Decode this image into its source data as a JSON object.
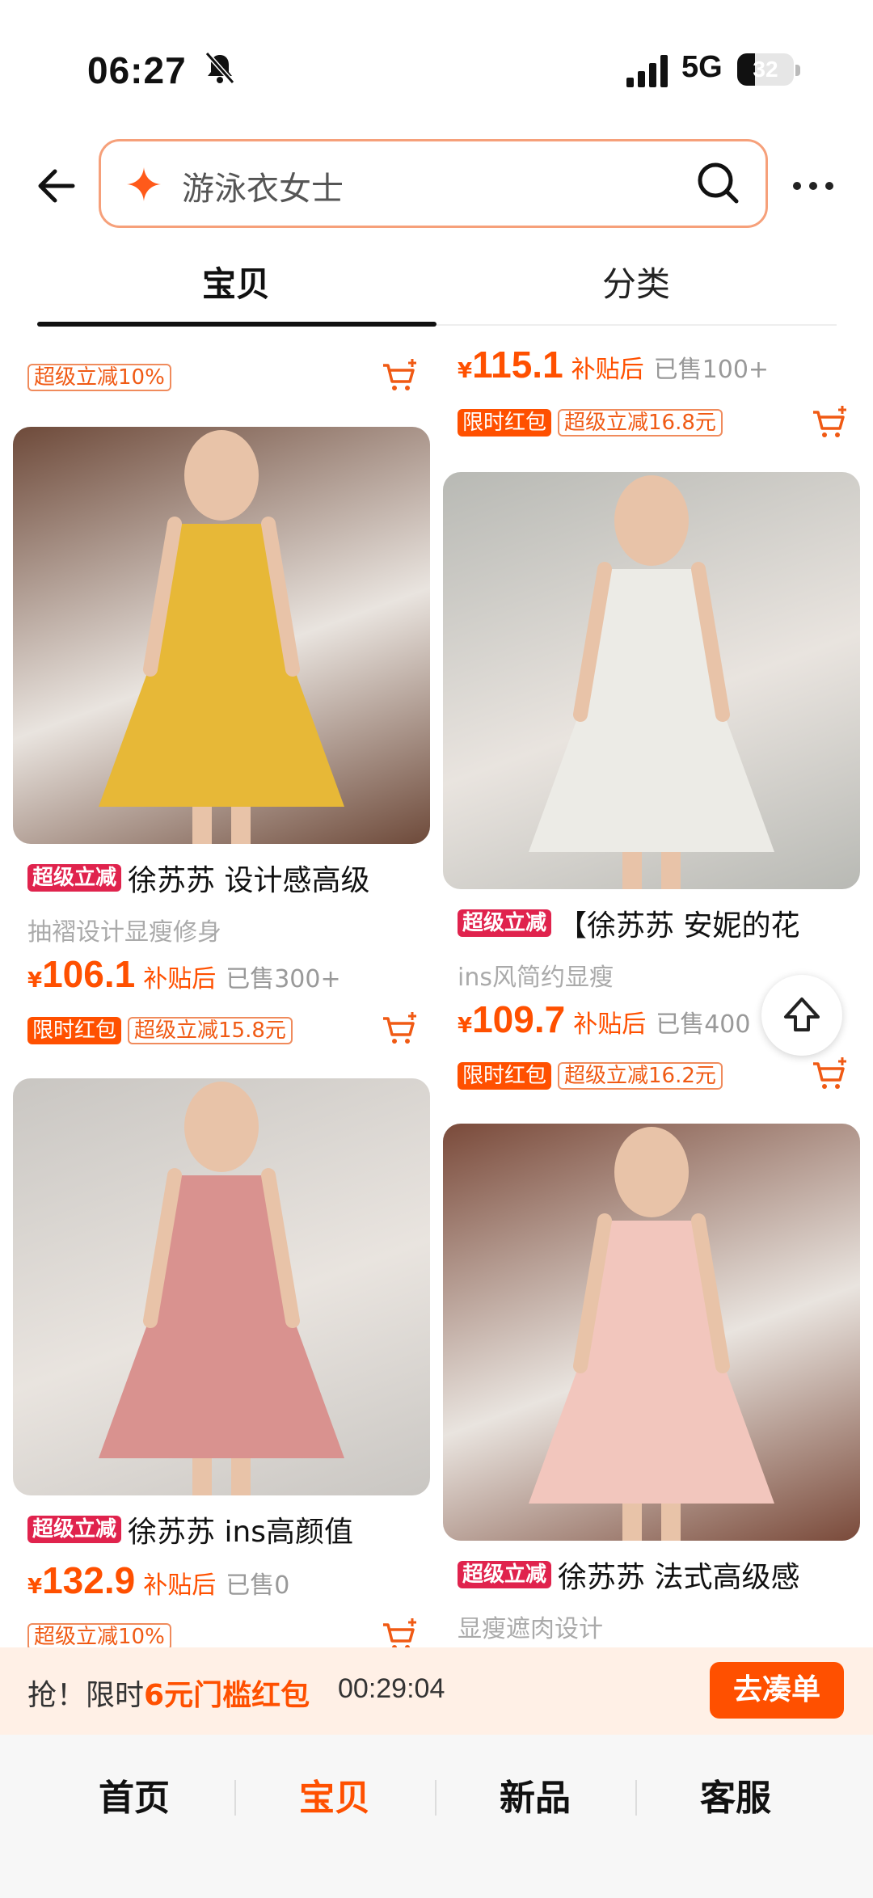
{
  "status_bar": {
    "time": "06:27",
    "network": "5G",
    "battery": "32",
    "battery_level": 0.32
  },
  "header": {
    "search_placeholder": "游泳衣女士"
  },
  "tabs": [
    {
      "label": "宝贝",
      "active": true
    },
    {
      "label": "分类",
      "active": false
    }
  ],
  "partial_top_left": {
    "tag": "超级立减10%"
  },
  "partial_top_right": {
    "yen": "¥",
    "price": "115.1",
    "after": "补贴后",
    "sold": "已售100+",
    "tag1": "限时红包",
    "tag2": "超级立减16.8元"
  },
  "products": [
    {
      "badge": "超级立减",
      "title": "徐苏苏 设计感高级",
      "subtitle": "抽褶设计显瘦修身",
      "yen": "¥",
      "price": "106.1",
      "after": "补贴后",
      "sold": "已售300+",
      "tag1": "限时红包",
      "tag2": "超级立减15.8元",
      "colors": [
        "#e7b837",
        "#6e4a3a"
      ]
    },
    {
      "badge": "超级立减",
      "title": "【徐苏苏 安妮的花",
      "subtitle": "ins风简约显瘦",
      "yen": "¥",
      "price": "109.7",
      "after": "补贴后",
      "sold": "已售400",
      "tag1": "限时红包",
      "tag2": "超级立减16.2元",
      "colors": [
        "#ecebe6",
        "#b8b9b4"
      ]
    },
    {
      "badge": "超级立减",
      "title": "徐苏苏 ins高颜值",
      "yen": "¥",
      "price": "132.9",
      "after": "补贴后",
      "sold": "已售0",
      "tag2": "超级立减10%",
      "colors": [
        "#d9928f",
        "#c9c6c2"
      ]
    },
    {
      "badge": "超级立减",
      "title": "徐苏苏 法式高级感",
      "subtitle": "显瘦遮肉设计",
      "colors": [
        "#f2c6bd",
        "#7a4a3a"
      ]
    }
  ],
  "promo": {
    "prefix": "抢！限时",
    "highlight": "6元门槛红包",
    "timer": "00:29:04",
    "button": "去凑单"
  },
  "bottom_nav": [
    "首页",
    "宝贝",
    "新品",
    "客服"
  ],
  "colors": {
    "accent": "#ff5000",
    "badge": "#e0234d"
  }
}
